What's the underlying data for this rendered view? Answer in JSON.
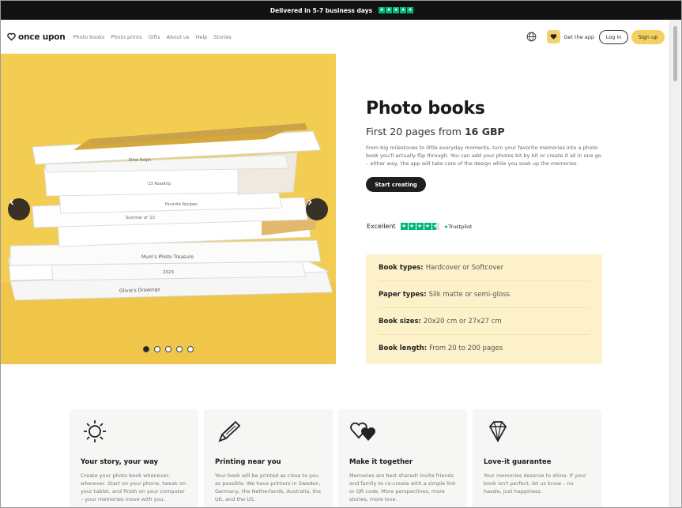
{
  "announcement": {
    "text": "Delivered in 5-7 business days",
    "trustpilot_color": "#00b67a"
  },
  "nav": {
    "logo": "once upon",
    "links": [
      "Photo books",
      "Photo prints",
      "Gifts",
      "About us",
      "Help",
      "Stories"
    ],
    "get_app": "Get the app",
    "login": "Log in",
    "signup": "Sign up",
    "accent": "#f3d060"
  },
  "hero": {
    "book_spines": [
      "Elliot Ralph",
      "'23 Roadtrip",
      "Favorite Recipes",
      "Summer of '23",
      "Mum's Photo Treasure",
      "2023",
      "Olivia's Drawings"
    ],
    "carousel": {
      "slides": 5,
      "active": 1
    },
    "title": "Photo books",
    "price_prefix": "First 20 pages from",
    "price_value": "16 GBP",
    "description": "From big milestones to little everyday moments, turn your favorite memories into a photo book you'll actually flip through. You can add your photos bit by bit or create it all in one go – either way, the app will take care of the design while you soak up the memories.",
    "cta": "Start creating",
    "rating_word": "Excellent",
    "trustpilot": "Trustpilot"
  },
  "specs": [
    {
      "label": "Book types:",
      "value": "Hardcover or Softcover"
    },
    {
      "label": "Paper types:",
      "value": "Silk matte or semi-gloss"
    },
    {
      "label": "Book sizes:",
      "value": "20x20 cm or 27x27 cm"
    },
    {
      "label": "Book length:",
      "value": "From 20 to 200 pages"
    }
  ],
  "features": [
    {
      "icon": "sun-icon",
      "title": "Your story, your way",
      "body": "Create your photo book whenever, wherever. Start on your phone, tweak on your tablet, and finish on your computer – your memories move with you."
    },
    {
      "icon": "pencil-icon",
      "title": "Printing near you",
      "body": "Your book will be printed as close to you as possible. We have printers in Sweden, Germany, the Netherlands, Australia, the UK, and the US."
    },
    {
      "icon": "hearts-icon",
      "title": "Make it together",
      "body": "Memories are best shared! Invite friends and family to co-create with a simple link or QR code. More perspectives, more stories, more love."
    },
    {
      "icon": "diamond-icon",
      "title": "Love-it guarantee",
      "body": "Your memories deserve to shine. If your book isn't perfect, let us know – no hassle, just happiness."
    }
  ]
}
